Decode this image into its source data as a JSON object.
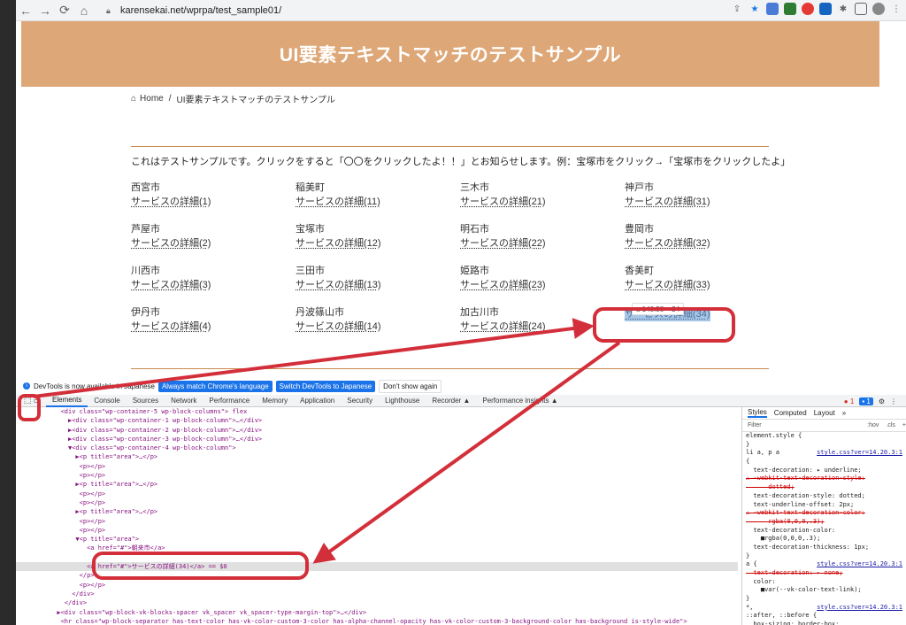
{
  "browser": {
    "url": "karensekai.net/wprpa/test_sample01/",
    "nav": {
      "back": "←",
      "forward": "→",
      "reload": "⟳",
      "home": "⌂"
    }
  },
  "page": {
    "banner_title": "UI要素テキストマッチのテストサンプル",
    "breadcrumb": {
      "home": "Home",
      "sep": "/",
      "current": "UI要素テキストマッチのテストサンプル"
    },
    "intro": "これはテストサンプルです。クリックをすると「〇〇をクリックしたよ！！」とお知らせします。例：宝塚市をクリック→「宝塚市をクリックしたよ」",
    "columns": [
      [
        {
          "city": "西宮市",
          "service": "サービスの詳細(1)"
        },
        {
          "city": "芦屋市",
          "service": "サービスの詳細(2)"
        },
        {
          "city": "川西市",
          "service": "サービスの詳細(3)"
        },
        {
          "city": "伊丹市",
          "service": "サービスの詳細(4)"
        }
      ],
      [
        {
          "city": "稲美町",
          "service": "サービスの詳細(11)"
        },
        {
          "city": "宝塚市",
          "service": "サービスの詳細(12)"
        },
        {
          "city": "三田市",
          "service": "サービスの詳細(13)"
        },
        {
          "city": "丹波篠山市",
          "service": "サービスの詳細(14)"
        }
      ],
      [
        {
          "city": "三木市",
          "service": "サービスの詳細(21)"
        },
        {
          "city": "明石市",
          "service": "サービスの詳細(22)"
        },
        {
          "city": "姫路市",
          "service": "サービスの詳細(23)"
        },
        {
          "city": "加古川市",
          "service": "サービスの詳細(24)"
        }
      ],
      [
        {
          "city": "神戸市",
          "service": "サービスの詳細(31)"
        },
        {
          "city": "豊岡市",
          "service": "サービスの詳細(32)"
        },
        {
          "city": "香美町",
          "service": "サービスの詳細(33)"
        },
        {
          "city": "",
          "service": "サービスの詳細(34)"
        }
      ]
    ],
    "tooltip": "a  140.58 × 24"
  },
  "devtools": {
    "infobar": {
      "message": "DevTools is now available in Japanese",
      "btn_language": "Always match Chrome's language",
      "btn_switch": "Switch DevTools to Japanese",
      "btn_dismiss": "Don't show again"
    },
    "tabs": [
      "Elements",
      "Console",
      "Sources",
      "Network",
      "Performance",
      "Memory",
      "Application",
      "Security",
      "Lighthouse",
      "Recorder ▲",
      "Performance insights ▲"
    ],
    "error_count": "1",
    "message_count": "1",
    "elements_lines": [
      "            <div class=\"wp-container-5 wp-block-columns\"> flex",
      "              ▶<div class=\"wp-container-1 wp-block-column\">…</div>",
      "              ▶<div class=\"wp-container-2 wp-block-column\">…</div>",
      "              ▶<div class=\"wp-container-3 wp-block-column\">…</div>",
      "              ▼<div class=\"wp-container-4 wp-block-column\">",
      "                ▶<p title=\"area\">…</p>",
      "                 <p></p>",
      "                 <p></p>",
      "                ▶<p title=\"area\">…</p>",
      "                 <p></p>",
      "                 <p></p>",
      "                ▶<p title=\"area\">…</p>",
      "                 <p></p>",
      "                 <p></p>",
      "                ▼<p title=\"area\">",
      "                   <a href=\"#\">朝来市</a>",
      "",
      "                   <a href=\"#\">サービスの詳細(34)</a> == $0",
      "                 </p>",
      "                 <p></p>",
      "               </div>",
      "             </div>",
      "           ▶<div class=\"wp-block-vk-blocks-spacer vk_spacer vk_spacer-type-margin-top\">…</div>",
      "            <hr class=\"wp-block-separator has-text-color has-vk-color-custom-3-color has-alpha-channel-opacity has-vk-color-custom-3-background-color has-background is-style-wide\">"
    ],
    "styles_tabs": [
      "Styles",
      "Computed",
      "Layout",
      "»"
    ],
    "filter_placeholder": "Filter",
    "filter_tools": [
      ":hov",
      ".cls",
      "+"
    ],
    "styles_lines": [
      {
        "t": "element.style {",
        "src": ""
      },
      {
        "t": "}",
        "src": ""
      },
      {
        "t": "li a, p a",
        "src": "style.css?ver=14.20.3:1"
      },
      {
        "t": "{",
        "src": ""
      },
      {
        "t": "  text-decoration: ▸ underline;",
        "src": ""
      },
      {
        "t": "⚠ -webkit-text-decoration-style:",
        "src": "",
        "strike": true
      },
      {
        "t": "      dotted;",
        "src": "",
        "strike": true
      },
      {
        "t": "  text-decoration-style: dotted;",
        "src": ""
      },
      {
        "t": "  text-underline-offset: 2px;",
        "src": ""
      },
      {
        "t": "⚠ -webkit-text-decoration-color:",
        "src": "",
        "strike": true
      },
      {
        "t": "      rgba(0,0,0,.3);",
        "src": "",
        "strike": true
      },
      {
        "t": "  text-decoration-color:",
        "src": ""
      },
      {
        "t": "    ■rgba(0,0,0,.3);",
        "src": ""
      },
      {
        "t": "  text-decoration-thickness: 1px;",
        "src": ""
      },
      {
        "t": "}",
        "src": ""
      },
      {
        "t": "a {",
        "src": "style.css?ver=14.20.3:1"
      },
      {
        "t": "  text-decoration: ▸ none;",
        "src": "",
        "strike": true
      },
      {
        "t": "  color:",
        "src": ""
      },
      {
        "t": "    ■var(--vk-color-text-link);",
        "src": ""
      },
      {
        "t": "}",
        "src": ""
      },
      {
        "t": "*,",
        "src": "style.css?ver=14.20.3:1"
      },
      {
        "t": "::after, ::before {",
        "src": ""
      },
      {
        "t": "  box-sizing: border-box;",
        "src": ""
      }
    ]
  },
  "colors": {
    "banner": "#dea777",
    "annotation": "#d32f3a",
    "highlight": "#a8c7e6"
  }
}
